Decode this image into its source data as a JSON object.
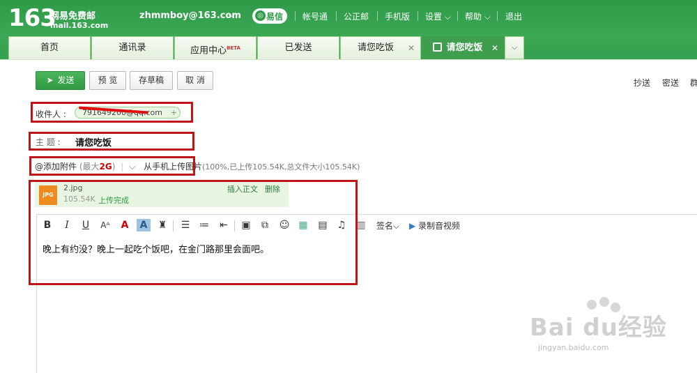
{
  "header": {
    "logo_number": "163",
    "logo_cn": "网易免费邮",
    "logo_domain": "mail.163.com",
    "user_email": "zhmmboy@163.com",
    "yixin_label": "易信",
    "nav": [
      "帐号通",
      "公正邮",
      "手机版",
      "设置",
      "帮助",
      "退出"
    ]
  },
  "tabs": [
    {
      "label": "首页"
    },
    {
      "label": "通讯录"
    },
    {
      "label": "应用中心",
      "badge": "BETA"
    },
    {
      "label": "已发送"
    },
    {
      "label": "请您吃饭"
    },
    {
      "label": "请您吃饭"
    }
  ],
  "toolbar": {
    "send": "发送",
    "preview": "预 览",
    "draft": "存草稿",
    "cancel": "取 消",
    "cc": "抄送",
    "bcc": "密送",
    "group": "群"
  },
  "recipient": {
    "label": "收件人 :",
    "value": "791649200@qq.com"
  },
  "subject": {
    "label": "主  题 :",
    "value": "请您吃饭"
  },
  "attachment": {
    "add_label": "添加附件",
    "limit_prefix": "(最大",
    "limit_value": "2G",
    "limit_suffix": ")",
    "mobile_upload": "从手机上传图片",
    "progress_info": "(100%,已上传105.54K,总文件大小105.54K)",
    "file": {
      "type_label": "JPG",
      "name": "2.jpg",
      "size": "105.54K",
      "status": "上传完成",
      "insert": "插入正文",
      "delete": "删除"
    }
  },
  "editor_toolbar": {
    "signature": "签名",
    "video": "录制音视频"
  },
  "message_body": "晚上有约没？晚上一起吃个饭吧，在金门路那里会面吧。",
  "watermark": {
    "main": "Bai du经验",
    "sub": "jingyan.baidu.com"
  },
  "colors": {
    "header_green": "#35a04f",
    "active_tab": "#3f9e4e",
    "highlight_red": "#c0141b"
  }
}
